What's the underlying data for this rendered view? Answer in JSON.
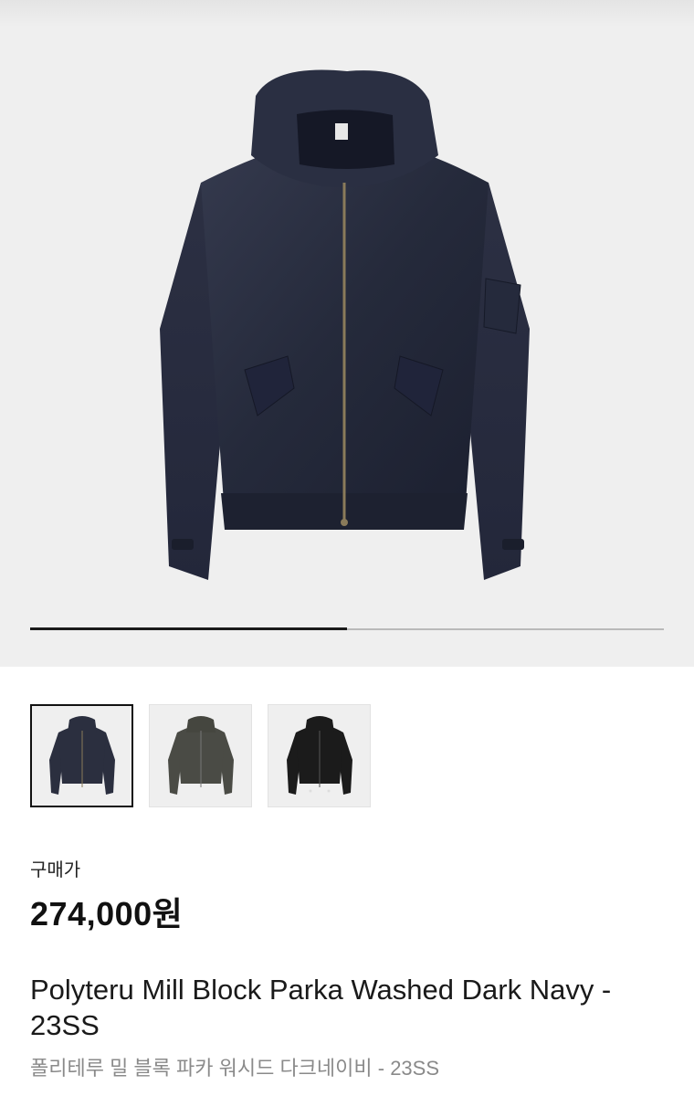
{
  "gallery": {
    "main_image": "hooded-parka-dark-navy",
    "progress": 0.5,
    "thumbnails": [
      {
        "image": "parka-dark-navy",
        "color": "#2b2f3f",
        "selected": true
      },
      {
        "image": "parka-olive-grey",
        "color": "#4a4b45",
        "selected": false
      },
      {
        "image": "parka-black",
        "color": "#1b1b1b",
        "selected": false
      }
    ]
  },
  "product": {
    "price_label": "구매가",
    "price": "274,000원",
    "title_en": "Polyteru Mill Block Parka Washed Dark Navy - 23SS",
    "title_ko": "폴리테루 밀 블록 파카 워시드 다크네이비 - 23SS"
  },
  "colors": {
    "accent": "#111111",
    "background": "#efefef",
    "secondary_text": "#8a8a8a"
  }
}
